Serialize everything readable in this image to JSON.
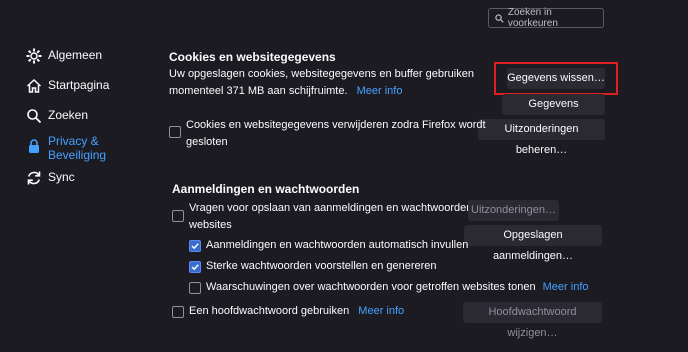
{
  "search": {
    "placeholder": "Zoeken in voorkeuren"
  },
  "sidebar": {
    "items": [
      {
        "label": "Algemeen",
        "icon": "gear-icon"
      },
      {
        "label": "Startpagina",
        "icon": "home-icon"
      },
      {
        "label": "Zoeken",
        "icon": "search-icon"
      },
      {
        "label": "Privacy &",
        "label2": "Beveiliging",
        "icon": "lock-icon",
        "active": true
      },
      {
        "label": "Sync",
        "icon": "sync-icon"
      }
    ]
  },
  "cookies": {
    "heading": "Cookies en websitegegevens",
    "desc_line1": "Uw opgeslagen cookies, websitegegevens en buffer gebruiken",
    "desc_line2": "momenteel 371 MB aan schijfruimte.",
    "learn_more": "Meer info",
    "clear_button": "Gegevens wissen…",
    "manage_button": "Gegevens beheren…",
    "exceptions_button": "Uitzonderingen beheren…",
    "delete_on_close_line1": "Cookies en websitegegevens verwijderen zodra Firefox wordt",
    "delete_on_close_line2": "gesloten",
    "delete_on_close_checked": false
  },
  "logins": {
    "heading": "Aanmeldingen en wachtwoorden",
    "ask_save_line1": "Vragen voor opslaan van aanmeldingen en wachtwoorden voor",
    "ask_save_line2": "websites",
    "ask_save_checked": false,
    "autofill": "Aanmeldingen en wachtwoorden automatisch invullen",
    "autofill_checked": true,
    "strong_pw": "Sterke wachtwoorden voorstellen en genereren",
    "strong_pw_checked": true,
    "breach_alerts": "Waarschuwingen over wachtwoorden voor getroffen websites tonen",
    "breach_alerts_checked": false,
    "breach_learn_more": "Meer info",
    "exceptions_button": "Uitzonderingen…",
    "saved_logins_button": "Opgeslagen aanmeldingen…",
    "primary_pw": "Een hoofdwachtwoord gebruiken",
    "primary_pw_checked": false,
    "primary_learn_more": "Meer info",
    "change_primary_button": "Hoofdwachtwoord wijzigen…"
  }
}
